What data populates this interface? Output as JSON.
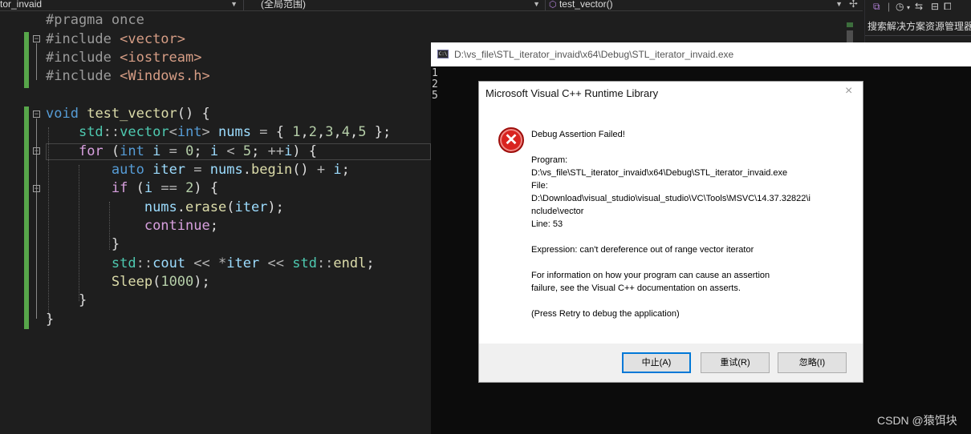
{
  "nav": {
    "project": "tor_invaid",
    "scope": "(全局范围)",
    "member": "test_vector()"
  },
  "solution_explorer": {
    "search_placeholder": "搜索解决方案资源管理器"
  },
  "code": [
    "#pragma once",
    "#include <vector>",
    "#include <iostream>",
    "#include <Windows.h>",
    "",
    "void test_vector() {",
    "    std::vector<int> nums = { 1,2,3,4,5 };",
    "    for (int i = 0; i < 5; ++i) {",
    "        auto iter = nums.begin() + i;",
    "        if (i == 2) {",
    "            nums.erase(iter);",
    "            continue;",
    "        }",
    "        std::cout << *iter << std::endl;",
    "        Sleep(1000);",
    "    }",
    "}"
  ],
  "console": {
    "title": "D:\\vs_file\\STL_iterator_invaid\\x64\\Debug\\STL_iterator_invaid.exe",
    "icon_text": "C:\\",
    "output": [
      "1",
      "2",
      "5"
    ]
  },
  "dialog": {
    "title": "Microsoft Visual C++ Runtime Library",
    "close": "×",
    "icon_glyph": "✕",
    "heading": "Debug Assertion Failed!",
    "program_label": "Program:",
    "program_path": "D:\\vs_file\\STL_iterator_invaid\\x64\\Debug\\STL_iterator_invaid.exe",
    "file_label": "File:",
    "file_path_1": "D:\\Download\\visual_studio\\visual_studio\\VC\\Tools\\MSVC\\14.37.32822\\i",
    "file_path_2": "nclude\\vector",
    "line": "Line: 53",
    "expression": "Expression: can't dereference out of range vector iterator",
    "info_1": "For information on how your program can cause an assertion",
    "info_2": "failure, see the Visual C++ documentation on asserts.",
    "press_retry": "(Press Retry to debug the application)",
    "buttons": {
      "abort": "中止(A)",
      "retry": "重试(R)",
      "ignore": "忽略(I)"
    }
  },
  "watermark": "CSDN @猿饵块"
}
